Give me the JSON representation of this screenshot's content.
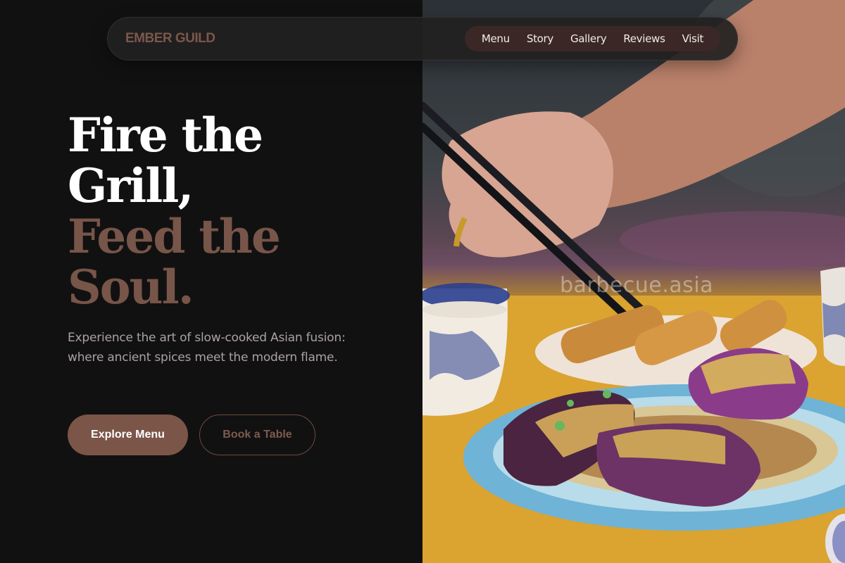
{
  "brand": {
    "name": "EMBER GUILD"
  },
  "nav": {
    "items": [
      "Menu",
      "Story",
      "Gallery",
      "Reviews",
      "Visit"
    ]
  },
  "hero": {
    "headline_light_1": "Fire the",
    "headline_light_2": "Grill,",
    "headline_accent_1": "Feed the",
    "headline_accent_2": "Soul.",
    "subtitle": "Experience the art of slow-cooked Asian fusion: where ancient spices meet the modern flame.",
    "primary_cta": "Explore Menu",
    "secondary_cta": "Book a Table"
  },
  "image": {
    "watermark": "barbecue.asia"
  },
  "colors": {
    "background": "#121111",
    "accent": "#7a5548",
    "nav_pill": "#3b2826",
    "text_primary": "#ffffff",
    "text_muted": "#a9a3a1"
  }
}
